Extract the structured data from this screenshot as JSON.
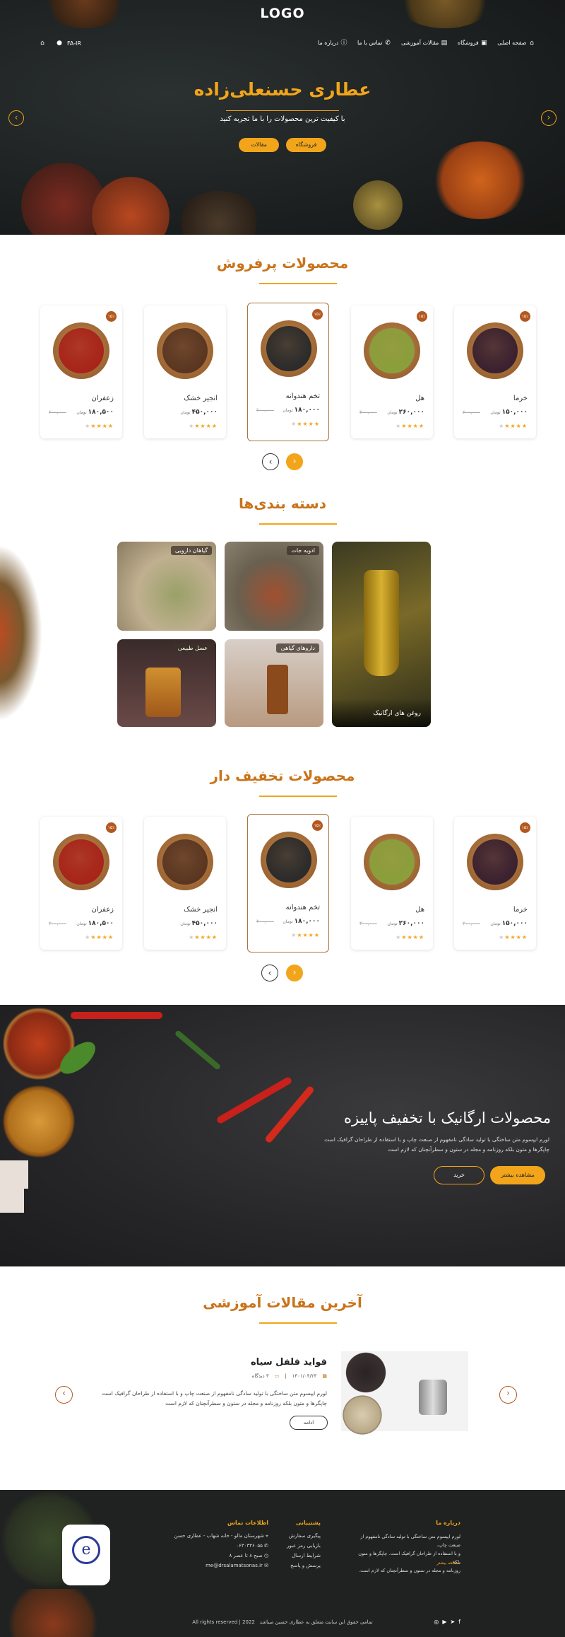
{
  "header": {
    "logo": "LOGO",
    "nav": [
      "صفحه اصلی",
      "فروشگاه",
      "مقالات آموزشی",
      "تماس با ما",
      "درباره ما"
    ],
    "lang": "FA-IR"
  },
  "hero": {
    "title": "عطاری حسنعلی‌زاده",
    "subtitle": "با کیفیت ترین محصولات را با ما تجربه کنید",
    "btn_shop": "فروشگاه",
    "btn_articles": "مقالات"
  },
  "bestsellers": {
    "title": "محصولات پرفروش",
    "products": [
      {
        "name": "خرما",
        "price": "۱۵۰,۰۰۰",
        "unit": "تومان",
        "old": "۲۰۰,۰۰۰",
        "badge": "۱۵٪",
        "color": "#3a2130",
        "active": false
      },
      {
        "name": "هل",
        "price": "۲۶۰,۰۰۰",
        "unit": "تومان",
        "old": "۳۰۰,۰۰۰",
        "badge": "۱۵٪",
        "color": "#8aa03c",
        "active": false
      },
      {
        "name": "تخم هندوانه",
        "price": "۱۸۰,۰۰۰",
        "unit": "تومان",
        "old": "۲۰۰,۰۰۰",
        "badge": "۱۵٪",
        "color": "#2b2b2b",
        "active": true
      },
      {
        "name": "انجیر خشک",
        "price": "۴۵۰,۰۰۰",
        "unit": "تومان",
        "old": "",
        "badge": "",
        "color": "#5a3622",
        "active": false
      },
      {
        "name": "زعفران",
        "price": "۱۸۰,۵۰۰",
        "unit": "تومان",
        "old": "۲۰۰,۰۰۰",
        "badge": "۱۵٪",
        "color": "#a8241a",
        "active": false
      }
    ]
  },
  "categories": {
    "title": "دسته بندی‌ها",
    "items": [
      "روغن های ارگانیک",
      "ادویه جات",
      "گیاهان دارویی",
      "داروهای گیاهی",
      "عسل طبیعی"
    ]
  },
  "discount": {
    "title": "محصولات تخفیف دار",
    "products": [
      {
        "name": "خرما",
        "price": "۱۵۰,۰۰۰",
        "unit": "تومان",
        "old": "۲۰۰,۰۰۰",
        "badge": "۱۵٪",
        "color": "#3a2130",
        "active": false
      },
      {
        "name": "هل",
        "price": "۲۶۰,۰۰۰",
        "unit": "تومان",
        "old": "۳۰۰,۰۰۰",
        "badge": "",
        "color": "#8aa03c",
        "active": false
      },
      {
        "name": "تخم هندوانه",
        "price": "۱۸۰,۰۰۰",
        "unit": "تومان",
        "old": "۲۰۰,۰۰۰",
        "badge": "۱۵٪",
        "color": "#2b2b2b",
        "active": true
      },
      {
        "name": "انجیر خشک",
        "price": "۴۵۰,۰۰۰",
        "unit": "تومان",
        "old": "",
        "badge": "",
        "color": "#5a3622",
        "active": false
      },
      {
        "name": "زعفران",
        "price": "۱۸۰,۵۰۰",
        "unit": "تومان",
        "old": "۲۰۰,۰۰۰",
        "badge": "۱۵٪",
        "color": "#a8241a",
        "active": false
      }
    ]
  },
  "promo": {
    "title": "محصولات ارگانیک با تخفیف پاییزه",
    "text1": "لورم ایپسوم متن ساختگی با تولید سادگی نامفهوم از صنعت چاپ و با استفاده از طراحان گرافیک است",
    "text2": "چاپگرها و متون بلکه روزنامه و مجله در ستون و سطرآنچنان که لازم است",
    "btn_more": "مشاهده بیشتر",
    "btn_buy": "خرید"
  },
  "articles": {
    "title": "آخرین مقالات آموزشی",
    "post_title": "فواید فلفل سیاه",
    "date": "۱۴۰۱/۰۴/۲۳",
    "comments": "۳ دیدگاه",
    "text1": "لورم ایپسوم متن ساختگی با تولید سادگی نامفهوم از صنعت چاپ و با استفاده از طراحان گرافیک است",
    "text2": "چاپگرها و متون بلکه روزنامه و مجله در ستون و سطرآنچنان که لازم است",
    "btn": "ادامه"
  },
  "footer": {
    "about_title": "درباره ما",
    "about_text": [
      "لورم ایپسوم متن ساختگی با تولید سادگی نامفهوم از صنعت چاپ،",
      "و با استفاده از طراحان گرافیک است. چاپگرها و متون بلکه",
      "روزنامه و مجله در ستون و سطرآنچنان که لازم است."
    ],
    "about_more": "مطالعه بیشتر",
    "support_title": "پشتیبانی",
    "support": [
      "پیگیری سفارش",
      "بازیابی رمز عبور",
      "شرایط ارسال",
      "پرسش و پاسخ"
    ],
    "contact_title": "اطلاعات تماس",
    "contact": [
      "شهرستان مالو - خانه شهاب - عطاری حسن",
      "۰۶۳۰۳۳۶۰۵۵",
      "صبح ۸ تا عصر ۸",
      "me@drsalamatsonas.ir"
    ],
    "copyright": "All rights reserved | 2022",
    "copyright_fa": "تمامی حقوق این سایت متعلق به عطاری حسین میباشد"
  }
}
